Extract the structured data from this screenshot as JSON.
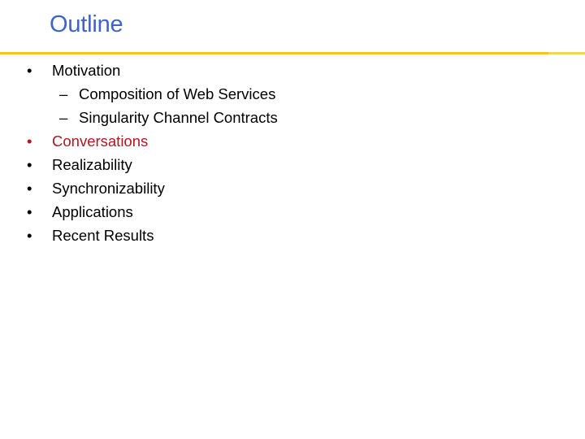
{
  "slide": {
    "title": "Outline",
    "accent_color": "#f5c518",
    "title_color": "#3f63c8",
    "highlight_color": "#b0171f"
  },
  "outline": {
    "items": [
      {
        "bullet": "•",
        "label": "Motivation",
        "level": 1,
        "active": false
      },
      {
        "bullet": "–",
        "label": "Composition of Web Services",
        "level": 2,
        "active": false
      },
      {
        "bullet": "–",
        "label": "Singularity Channel Contracts",
        "level": 2,
        "active": false
      },
      {
        "bullet": "•",
        "label": "Conversations",
        "level": 1,
        "active": true
      },
      {
        "bullet": "•",
        "label": "Realizability",
        "level": 1,
        "active": false
      },
      {
        "bullet": "•",
        "label": "Synchronizability",
        "level": 1,
        "active": false
      },
      {
        "bullet": "•",
        "label": "Applications",
        "level": 1,
        "active": false
      },
      {
        "bullet": "•",
        "label": "Recent Results",
        "level": 1,
        "active": false
      }
    ]
  }
}
